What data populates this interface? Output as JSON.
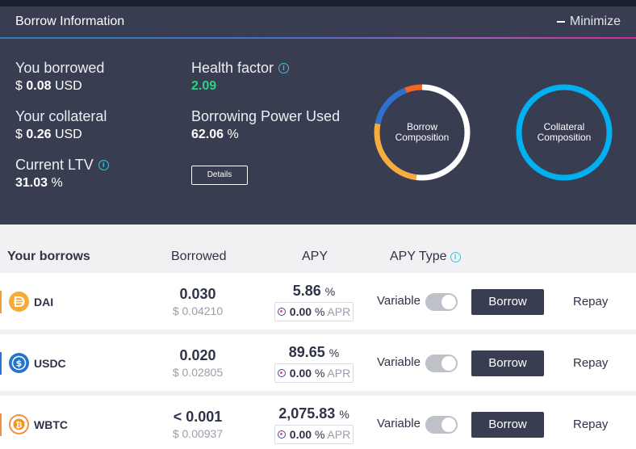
{
  "panel": {
    "title": "Borrow Information",
    "minimize_label": "Minimize",
    "you_borrowed": {
      "label": "You borrowed",
      "currency": "$",
      "value": "0.08",
      "unit": "USD"
    },
    "your_collateral": {
      "label": "Your collateral",
      "currency": "$",
      "value": "0.26",
      "unit": "USD"
    },
    "current_ltv": {
      "label": "Current LTV",
      "value": "31.03",
      "unit": "%"
    },
    "health_factor": {
      "label": "Health factor",
      "value": "2.09"
    },
    "borrowing_power_used": {
      "label": "Borrowing Power Used",
      "value": "62.06",
      "unit": "%"
    },
    "details_label": "Details",
    "borrow_composition": {
      "label": "Borrow Composition",
      "segments": [
        {
          "name": "DAI",
          "fraction": 0.52,
          "color": "#ffffff"
        },
        {
          "name": "USDC",
          "fraction": 0.26,
          "color": "#f7ac40"
        },
        {
          "name": "WBTC",
          "fraction": 0.16,
          "color": "#2f6fce"
        },
        {
          "name": "other",
          "fraction": 0.06,
          "color": "#f26522"
        }
      ]
    },
    "collateral_composition": {
      "label": "Collateral Composition",
      "segments": [
        {
          "name": "collateral",
          "fraction": 1.0,
          "color": "#00b0f0"
        }
      ]
    }
  },
  "table": {
    "headers": {
      "asset": "Your borrows",
      "borrowed": "Borrowed",
      "apy": "APY",
      "apy_type": "APY Type"
    },
    "rows": [
      {
        "symbol": "DAI",
        "icon": "dai-icon",
        "amount": "0.030",
        "usd": "$ 0.04210",
        "apy": "5.86",
        "apy_unit": "%",
        "apr": "0.00",
        "apr_unit": "%",
        "apr_label": "APR",
        "type": "Variable",
        "borrow_label": "Borrow",
        "repay_label": "Repay",
        "accent": "#f0a02c"
      },
      {
        "symbol": "USDC",
        "icon": "usdc-icon",
        "amount": "0.020",
        "usd": "$ 0.02805",
        "apy": "89.65",
        "apy_unit": "%",
        "apr": "0.00",
        "apr_unit": "%",
        "apr_label": "APR",
        "type": "Variable",
        "borrow_label": "Borrow",
        "repay_label": "Repay",
        "accent": "#2775ca"
      },
      {
        "symbol": "WBTC",
        "icon": "wbtc-icon",
        "amount": "< 0.001",
        "usd": "$ 0.00937",
        "apy": "2,075.83",
        "apy_unit": "%",
        "apr": "0.00",
        "apr_unit": "%",
        "apr_label": "APR",
        "type": "Variable",
        "borrow_label": "Borrow",
        "repay_label": "Repay",
        "accent": "#f09242"
      }
    ]
  },
  "colors": {
    "panel_bg": "#383d51",
    "health_green": "#2bd382",
    "info_teal": "#3fc3d7"
  }
}
